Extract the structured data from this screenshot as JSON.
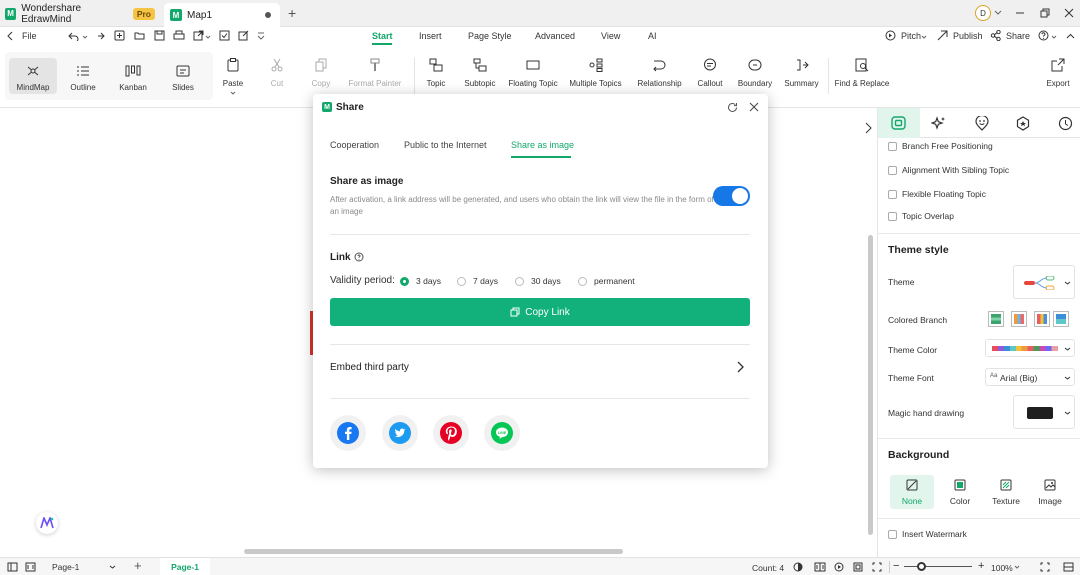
{
  "titlebar": {
    "app_name": "Wondershare EdrawMind",
    "pro_badge": "Pro",
    "doc_tab": "Map1",
    "avatar_letter": "D"
  },
  "menubar": {
    "file": "File",
    "tabs": [
      "Start",
      "Insert",
      "Page Style",
      "Advanced",
      "View",
      "AI"
    ],
    "active_tab": "Start",
    "pitch": "Pitch",
    "publish": "Publish",
    "share": "Share"
  },
  "ribbon": {
    "views": [
      "MindMap",
      "Outline",
      "Kanban",
      "Slides"
    ],
    "paste": "Paste",
    "cut": "Cut",
    "copy": "Copy",
    "format_painter": "Format Painter",
    "topic": "Topic",
    "subtopic": "Subtopic",
    "floating_topic": "Floating Topic",
    "multiple_topics": "Multiple Topics",
    "relationship": "Relationship",
    "callout": "Callout",
    "boundary": "Boundary",
    "summary": "Summary",
    "find_replace": "Find & Replace",
    "export": "Export"
  },
  "share_dialog": {
    "title": "Share",
    "tabs": [
      "Cooperation",
      "Public to the Internet",
      "Share as image"
    ],
    "active_tab": "Share as image",
    "section_title": "Share as image",
    "description": "After activation, a link address will be generated, and users who obtain the link will view the file in the form of an image",
    "toggle_on": true,
    "link_title": "Link",
    "validity_label": "Validity period:",
    "validity_options": [
      "3 days",
      "7 days",
      "30 days",
      "permanent"
    ],
    "validity_selected": "3 days",
    "copy_link": "Copy Link",
    "embed": "Embed third party",
    "accent": "#12a86b"
  },
  "right_panel": {
    "checkboxes": [
      "Branch Free Positioning",
      "Alignment With Sibling Topic",
      "Flexible Floating Topic",
      "Topic Overlap"
    ],
    "theme_style_title": "Theme style",
    "theme_label": "Theme",
    "colored_branch_label": "Colored Branch",
    "theme_color_label": "Theme Color",
    "theme_font_label": "Theme Font",
    "theme_font_value": "Arial (Big)",
    "magic_hand_label": "Magic hand drawing",
    "background_title": "Background",
    "bg_options": [
      "None",
      "Color",
      "Texture",
      "Image"
    ],
    "bg_selected": "None",
    "watermark": "Insert Watermark"
  },
  "statusbar": {
    "page_select": "Page-1",
    "page_tab": "Page-1",
    "count": "Count: 4",
    "zoom": "100%"
  }
}
